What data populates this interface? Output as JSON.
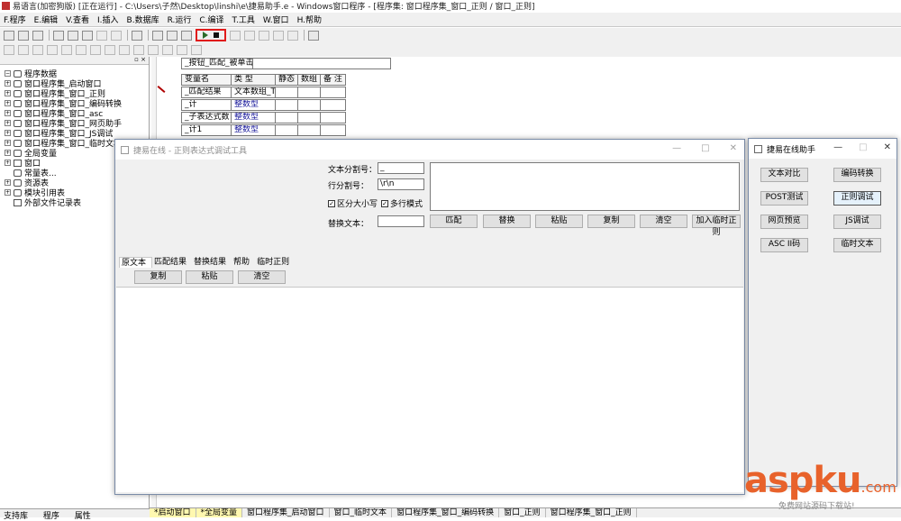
{
  "titlebar": {
    "text": "易语言(加密狗版) [正在运行] - C:\\Users\\子然\\Desktop\\linshi\\e\\捷易助手.e - Windows窗口程序 - [程序集: 窗口程序集_窗口_正则 / 窗口_正则]"
  },
  "menu": [
    "F.程序",
    "E.编辑",
    "V.查看",
    "I.插入",
    "B.数据库",
    "R.运行",
    "C.编译",
    "T.工具",
    "W.窗口",
    "H.帮助"
  ],
  "tree": {
    "root": "程序数据",
    "items": [
      "窗口程序集_启动窗口",
      "窗口程序集_窗口_正则",
      "窗口程序集_窗口_编码转换",
      "窗口程序集_窗口_asc",
      "窗口程序集_窗口_网页助手",
      "窗口程序集_窗口_JS调试",
      "窗口程序集_窗口_临时文本"
    ],
    "other": [
      "全局变量",
      "窗口",
      "常量表...",
      "资源表",
      "模块引用表",
      "外部文件记录表"
    ]
  },
  "code": {
    "sub_name": "_按钮_匹配_被单击",
    "headers": [
      "变量名",
      "类 型",
      "静态",
      "数组",
      "备 注"
    ],
    "rows": [
      {
        "name": "_匹配结果",
        "type": "文本数组_T"
      },
      {
        "name": "_计",
        "type": "整数型"
      },
      {
        "name": "_子表达式数",
        "type": "整数型"
      },
      {
        "name": "_计1",
        "type": "整数型"
      }
    ]
  },
  "regex_window": {
    "title": "捷易在线 - 正则表达式调试工具",
    "text_sep_label": "文本分割号：",
    "text_sep_value": "_",
    "line_sep_label": "行分割号：",
    "line_sep_value": "\\r\\n",
    "case_label": "区分大小写",
    "multiline_label": "多行模式",
    "replace_label": "替换文本：",
    "buttons": [
      "匹配",
      "替换",
      "粘贴",
      "复制",
      "清空",
      "加入临时正则"
    ],
    "tabs": [
      "原文本",
      "匹配结果",
      "替换结果",
      "帮助",
      "临时正则"
    ],
    "tab_buttons": [
      "复制",
      "粘贴",
      "清空"
    ]
  },
  "helper_window": {
    "title": "捷易在线助手",
    "buttons": [
      "文本对比",
      "编码转换",
      "POST测试",
      "正则调试",
      "网页预览",
      "JS调试",
      "ASC II码",
      "临时文本"
    ]
  },
  "bottom_tabs": [
    "*启动窗口",
    "*全局变量",
    "窗口程序集_启动窗口",
    "窗口_临时文本",
    "窗口程序集_窗口_编码转换",
    "窗口_正则",
    "窗口程序集_窗口_正则"
  ],
  "left_bottom_tabs": [
    "支持库",
    "程序",
    "属性"
  ],
  "watermark": {
    "brand": "aspku",
    "tld": ".com",
    "slogan": "免费网站源码下载站!"
  }
}
